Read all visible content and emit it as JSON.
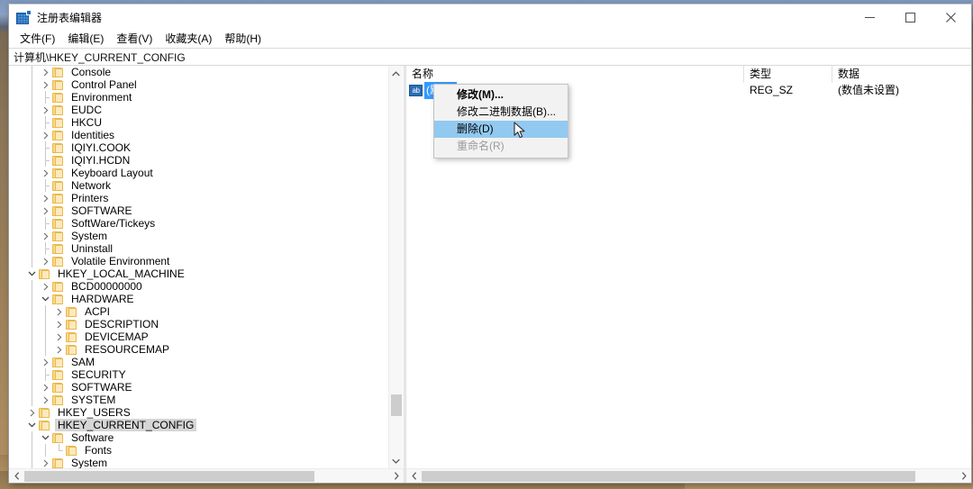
{
  "window": {
    "title": "注册表编辑器",
    "app_icon": "registry-editor-icon",
    "controls": {
      "minimize": "minimize-icon",
      "maximize": "maximize-icon",
      "close": "close-icon"
    }
  },
  "menubar": {
    "items": [
      {
        "label": "文件(F)"
      },
      {
        "label": "编辑(E)"
      },
      {
        "label": "查看(V)"
      },
      {
        "label": "收藏夹(A)"
      },
      {
        "label": "帮助(H)"
      }
    ]
  },
  "address": {
    "path": "计算机\\HKEY_CURRENT_CONFIG"
  },
  "tree": {
    "items": [
      {
        "label": "Console",
        "indent": 2,
        "state": "collapsed"
      },
      {
        "label": "Control Panel",
        "indent": 2,
        "state": "collapsed"
      },
      {
        "label": "Environment",
        "indent": 2,
        "state": "leaf"
      },
      {
        "label": "EUDC",
        "indent": 2,
        "state": "collapsed"
      },
      {
        "label": "HKCU",
        "indent": 2,
        "state": "leaf"
      },
      {
        "label": "Identities",
        "indent": 2,
        "state": "collapsed"
      },
      {
        "label": "IQIYI.COOK",
        "indent": 2,
        "state": "leaf"
      },
      {
        "label": "IQIYI.HCDN",
        "indent": 2,
        "state": "leaf"
      },
      {
        "label": "Keyboard Layout",
        "indent": 2,
        "state": "collapsed"
      },
      {
        "label": "Network",
        "indent": 2,
        "state": "leaf"
      },
      {
        "label": "Printers",
        "indent": 2,
        "state": "collapsed"
      },
      {
        "label": "SOFTWARE",
        "indent": 2,
        "state": "collapsed"
      },
      {
        "label": "SoftWare/Tickeys",
        "indent": 2,
        "state": "leaf"
      },
      {
        "label": "System",
        "indent": 2,
        "state": "collapsed"
      },
      {
        "label": "Uninstall",
        "indent": 2,
        "state": "leaf"
      },
      {
        "label": "Volatile Environment",
        "indent": 2,
        "state": "collapsed"
      },
      {
        "label": "HKEY_LOCAL_MACHINE",
        "indent": 1,
        "state": "expanded"
      },
      {
        "label": "BCD00000000",
        "indent": 2,
        "state": "collapsed"
      },
      {
        "label": "HARDWARE",
        "indent": 2,
        "state": "expanded"
      },
      {
        "label": "ACPI",
        "indent": 3,
        "state": "collapsed"
      },
      {
        "label": "DESCRIPTION",
        "indent": 3,
        "state": "collapsed"
      },
      {
        "label": "DEVICEMAP",
        "indent": 3,
        "state": "collapsed"
      },
      {
        "label": "RESOURCEMAP",
        "indent": 3,
        "state": "collapsed"
      },
      {
        "label": "SAM",
        "indent": 2,
        "state": "collapsed"
      },
      {
        "label": "SECURITY",
        "indent": 2,
        "state": "leaf"
      },
      {
        "label": "SOFTWARE",
        "indent": 2,
        "state": "collapsed"
      },
      {
        "label": "SYSTEM",
        "indent": 2,
        "state": "collapsed"
      },
      {
        "label": "HKEY_USERS",
        "indent": 1,
        "state": "collapsed"
      },
      {
        "label": "HKEY_CURRENT_CONFIG",
        "indent": 1,
        "state": "expanded",
        "selected": true
      },
      {
        "label": "Software",
        "indent": 2,
        "state": "expanded"
      },
      {
        "label": "Fonts",
        "indent": 3,
        "state": "leaf"
      },
      {
        "label": "System",
        "indent": 2,
        "state": "collapsed"
      }
    ]
  },
  "list": {
    "columns": [
      {
        "label": "名称"
      },
      {
        "label": "类型"
      },
      {
        "label": "数据"
      }
    ],
    "rows": [
      {
        "icon": "string-value-icon",
        "name": "(默认)",
        "type": "REG_SZ",
        "data": "(数值未设置)",
        "selected": true
      }
    ]
  },
  "context_menu": {
    "items": [
      {
        "label": "修改(M)...",
        "bold": true,
        "state": "normal"
      },
      {
        "label": "修改二进制数据(B)...",
        "bold": false,
        "state": "normal"
      },
      {
        "label": "删除(D)",
        "bold": false,
        "state": "highlighted"
      },
      {
        "label": "重命名(R)",
        "bold": false,
        "state": "disabled"
      }
    ]
  },
  "colors": {
    "highlight": "#92c9f0",
    "selection": "#3399ff",
    "tree_selection": "#d6d6d6",
    "folder": "#fcd88a",
    "accent": "#2a6fb5"
  },
  "scrollbars": {
    "tree_vertical": {
      "icon_up": "chevron-up-icon",
      "icon_down": "chevron-down-icon"
    },
    "tree_horizontal": {
      "icon_left": "chevron-left-icon",
      "icon_right": "chevron-right-icon"
    },
    "list_horizontal": {
      "icon_left": "chevron-left-icon",
      "icon_right": "chevron-right-icon"
    }
  }
}
